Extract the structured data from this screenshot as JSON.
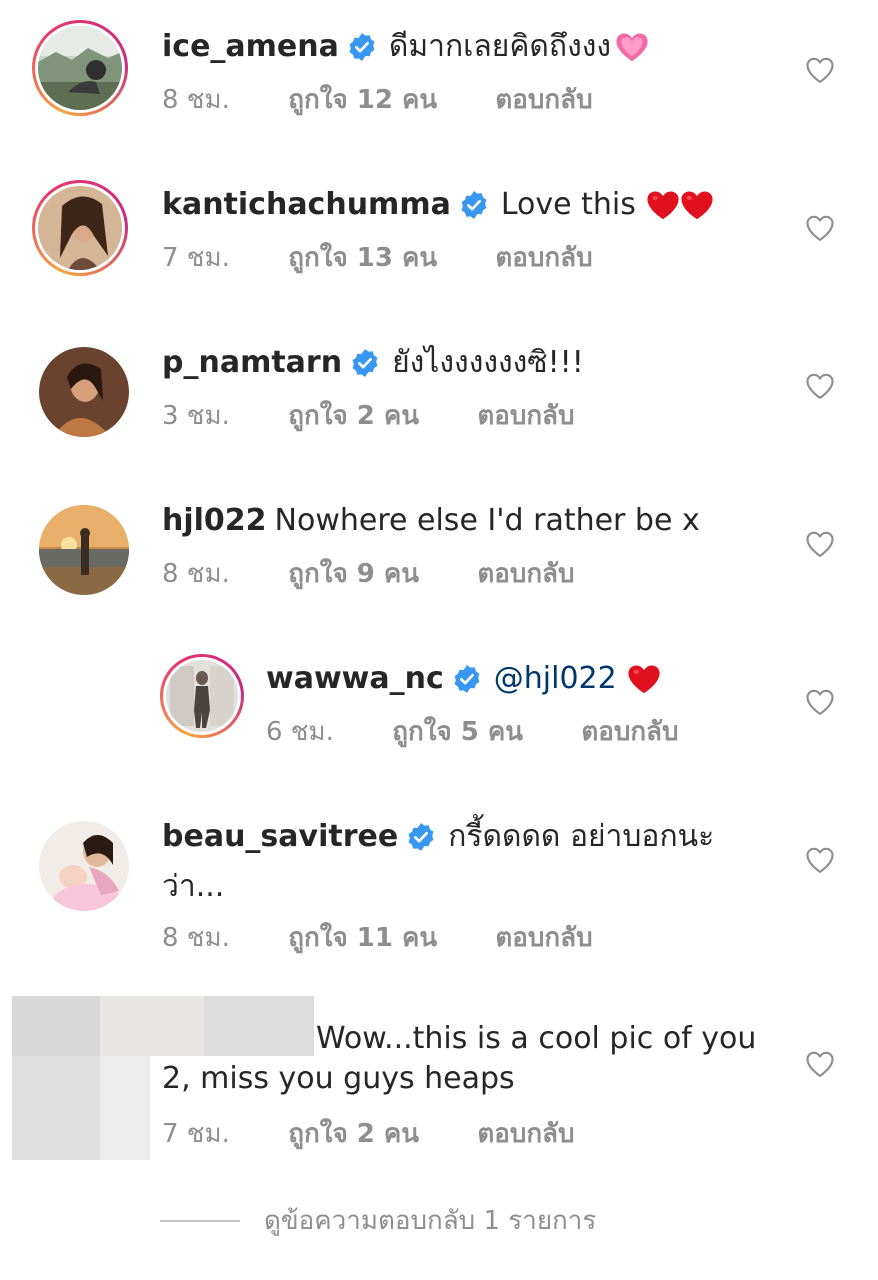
{
  "comments": [
    {
      "username": "ice_amena",
      "verified": true,
      "text": "ดีมากเลยคิดถึงงง",
      "time": "8 ชม.",
      "likes": "ถูกใจ 12 คน",
      "reply": "ตอบกลับ",
      "emoji": "pink-heart"
    },
    {
      "username": "kantichachumma",
      "verified": true,
      "text": "Love this",
      "time": "7 ชม.",
      "likes": "ถูกใจ 13 คน",
      "reply": "ตอบกลับ",
      "emoji": "red-heart-x2"
    },
    {
      "username": "p_namtarn",
      "verified": true,
      "text": "ยังไงงงงงงซิ!!!",
      "time": "3 ชม.",
      "likes": "ถูกใจ 2 คน",
      "reply": "ตอบกลับ"
    },
    {
      "username": "hjl022",
      "verified": false,
      "text": "Nowhere else I'd rather be x",
      "time": "8 ชม.",
      "likes": "ถูกใจ 9 คน",
      "reply": "ตอบกลับ"
    },
    {
      "username": "wawwa_nc",
      "verified": true,
      "is_reply": true,
      "mention": "@hjl022",
      "time": "6 ชม.",
      "likes": "ถูกใจ 5 คน",
      "reply": "ตอบกลับ",
      "emoji": "red-heart"
    },
    {
      "username": "beau_savitree",
      "verified": true,
      "text": "กรี้ดดดด อย่าบอกนะ",
      "text_line2": "ว่า...",
      "time": "8 ชม.",
      "likes": "ถูกใจ 11 คน",
      "reply": "ตอบกลับ"
    },
    {
      "username_hidden": true,
      "text": "Wow...this is a cool pic of you",
      "text_line2": "2, miss you guys heaps",
      "time": "7 ชม.",
      "likes": "ถูกใจ 2 คน",
      "reply": "ตอบกลับ"
    }
  ],
  "footer": {
    "view_replies": "ดูข้อความตอบกลับ 1 รายการ"
  },
  "icons": {
    "verified": "verified-badge-icon",
    "like": "heart-outline-icon"
  },
  "colors": {
    "verified_blue": "#3897f0",
    "mention": "#00376b",
    "meta_gray": "#8e8e8e",
    "emoji_red": "#e0101e",
    "emoji_pink": "#f06aa6"
  }
}
